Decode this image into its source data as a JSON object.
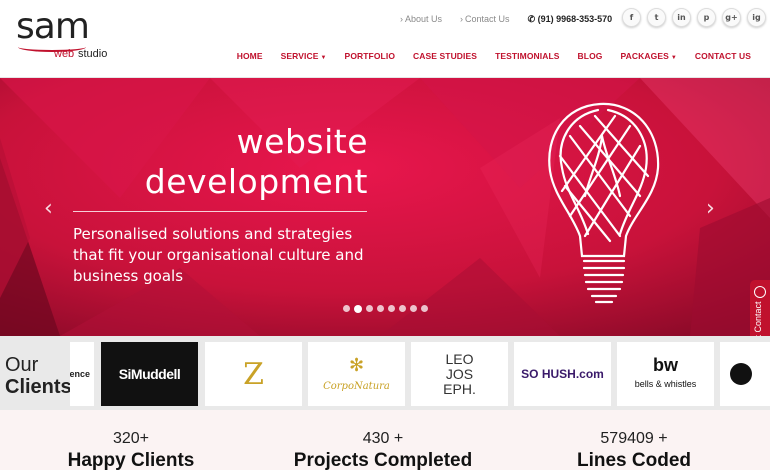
{
  "brand": {
    "logo_word": "sam",
    "logo_web": "web",
    "logo_studio": "studio"
  },
  "top_links": {
    "about": "About Us",
    "contact": "Contact Us",
    "phone": "(91) 9968-353-570"
  },
  "social": [
    "f",
    "t",
    "in",
    "p",
    "g+",
    "ig"
  ],
  "nav": {
    "home": "HOME",
    "service": "SERVICE",
    "portfolio": "PORTFOLIO",
    "case_studies": "CASE STUDIES",
    "testimonials": "TESTIMONIALS",
    "blog": "BLOG",
    "packages": "PACKAGES",
    "contact": "CONTACT US"
  },
  "hero": {
    "title_line1": "website",
    "title_line2": "development",
    "subtitle": "Personalised solutions and strategies that fit your organisational culture and business goals",
    "slide_count": 8,
    "active_slide": 2
  },
  "quick_contact": "Quick Contact",
  "clients": {
    "label_top": "Our",
    "label_bottom": "Clients",
    "logos": [
      "ence",
      "SiMuddell",
      "Z",
      "CorpoNatura",
      "LEO JOS EPH.",
      "SO HUSH.com",
      "bells & whistles",
      ""
    ]
  },
  "stats": [
    {
      "num": "320+",
      "label": "Happy Clients"
    },
    {
      "num": "430 +",
      "label": "Projects Completed"
    },
    {
      "num": "579409 +",
      "label": "Lines Coded"
    }
  ],
  "colors": {
    "brand_red": "#c0112d",
    "hero_bg": "#c8123a"
  }
}
